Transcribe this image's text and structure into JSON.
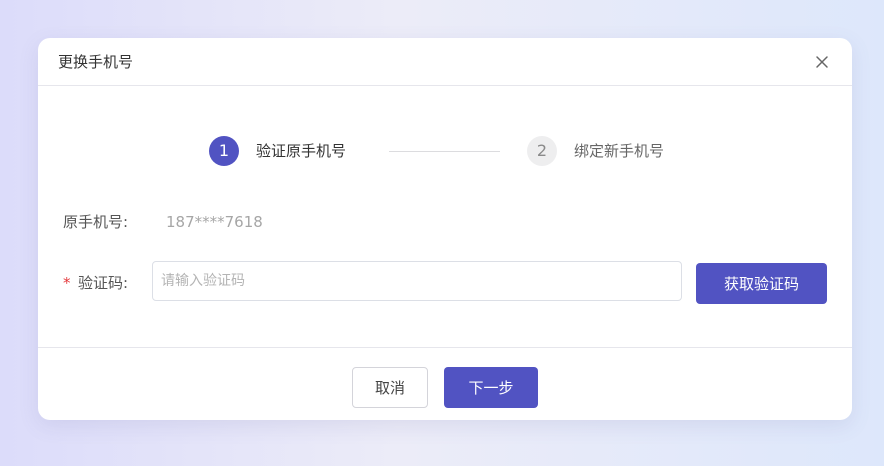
{
  "dialog": {
    "title": "更换手机号",
    "close_icon": "close-icon"
  },
  "steps": [
    {
      "number": "1",
      "label": "验证原手机号",
      "state": "active"
    },
    {
      "number": "2",
      "label": "绑定新手机号",
      "state": "inactive"
    }
  ],
  "form": {
    "original_phone_label": "原手机号:",
    "original_phone_value": "187****7618",
    "required_mark": "*",
    "code_label": "验证码:",
    "code_value": "",
    "code_placeholder": "请输入验证码",
    "get_code_button": "获取验证码"
  },
  "footer": {
    "cancel_label": "取消",
    "next_label": "下一步"
  },
  "colors": {
    "accent": "#5153c2",
    "required": "#e4393c",
    "background_left": "#dcdcfa",
    "background_right": "#dde7fb"
  }
}
